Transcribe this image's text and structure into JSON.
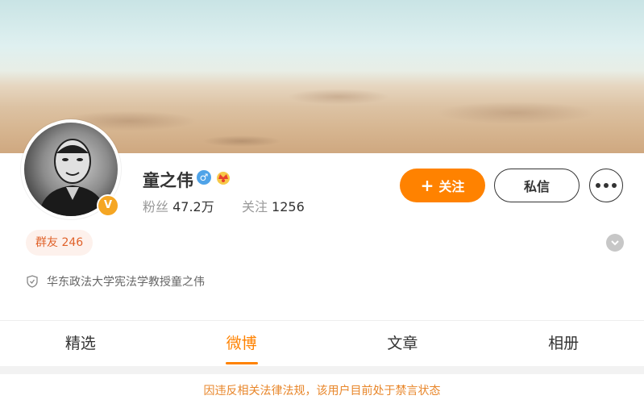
{
  "profile": {
    "name": "童之伟",
    "followers_label": "粉丝",
    "followers_value": "47.2万",
    "following_label": "关注",
    "following_value": "1256",
    "verified_badge": "V",
    "gender_symbol": "♂"
  },
  "actions": {
    "follow_plus": "+",
    "follow_label": "关注",
    "message_label": "私信"
  },
  "group": {
    "label": "群友 246"
  },
  "bio": {
    "text": "华东政法大学宪法学教授童之伟"
  },
  "tabs": [
    {
      "label": "精选"
    },
    {
      "label": "微博"
    },
    {
      "label": "文章"
    },
    {
      "label": "相册"
    }
  ],
  "notice": {
    "text": "因违反相关法律法规，该用户目前处于禁言状态"
  },
  "colors": {
    "accent": "#ff8200",
    "verified": "#f5a623",
    "gender": "#4fa3e8",
    "notice": "#e8862a"
  },
  "icons": [
    "male-icon",
    "crown-icon",
    "verified-icon",
    "more-icon",
    "chevron-down-icon",
    "shield-icon"
  ]
}
